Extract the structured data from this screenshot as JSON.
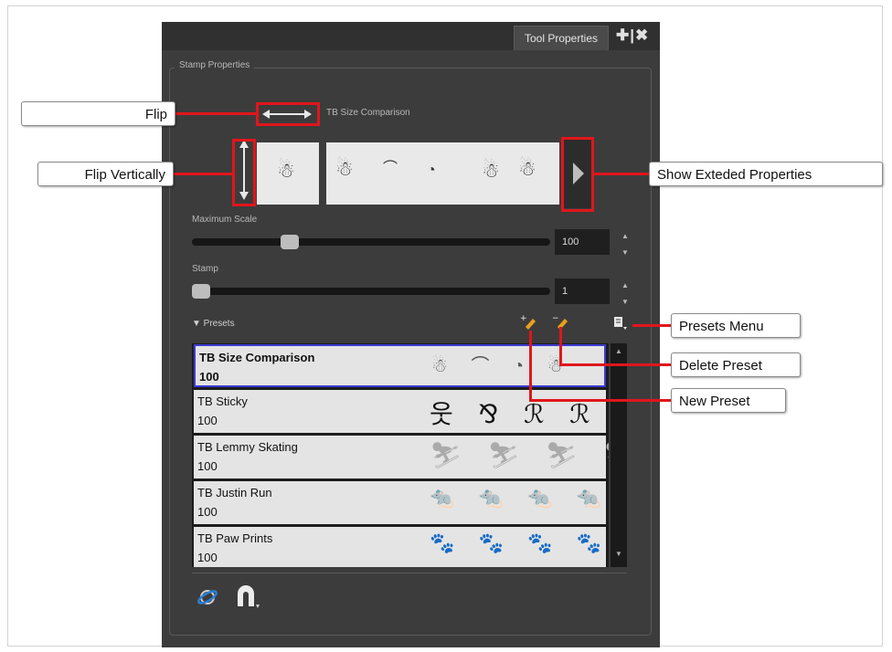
{
  "panel": {
    "tab_label": "Tool Properties",
    "tab_icons": "✚|✖",
    "group_label": "Stamp Properties",
    "stamp_name": "TB Size Comparison",
    "max_scale_label": "Maximum Scale",
    "max_scale_value": "100",
    "max_scale_level": 0.26,
    "stamp_label": "Stamp",
    "stamp_value": "1",
    "stamp_level": 0.0,
    "presets_label": "▼ Presets"
  },
  "presets": [
    {
      "name": "TB Size Comparison",
      "size": "100",
      "strokes": "☃ ⌒ ◔ ☃"
    },
    {
      "name": "TB Sticky",
      "size": "100",
      "strokes": "웃 ⅋ ℛ ℛ"
    },
    {
      "name": "TB Lemmy Skating",
      "size": "100",
      "strokes": "⛷ ⛷ ⛷ ⛷"
    },
    {
      "name": "TB Justin Run",
      "size": "100",
      "strokes": "🐀 🐀 🐀 🐀"
    },
    {
      "name": "TB Paw Prints",
      "size": "100",
      "strokes": "🐾 🐾 🐾 🐾"
    }
  ],
  "callouts": {
    "flip": "Flip",
    "flip_vertically": "Flip Vertically",
    "show_extended": "Show Exteded Properties",
    "presets_menu": "Presets Menu",
    "delete_preset": "Delete Preset",
    "new_preset": "New Preset"
  },
  "colors": {
    "highlight": "#e0161b",
    "selection": "#3b3bd6",
    "panel": "#3c3c3c"
  },
  "icons": {
    "flip": "horizontal-double-arrow",
    "flip_vertical": "vertical-double-arrow",
    "show_extended": "triangle-right",
    "new_preset": "pencil-plus",
    "delete_preset": "pencil-minus",
    "presets_menu": "menu-doc",
    "bottom_left": "orbit-icon",
    "bottom_right": "magnet-icon"
  }
}
